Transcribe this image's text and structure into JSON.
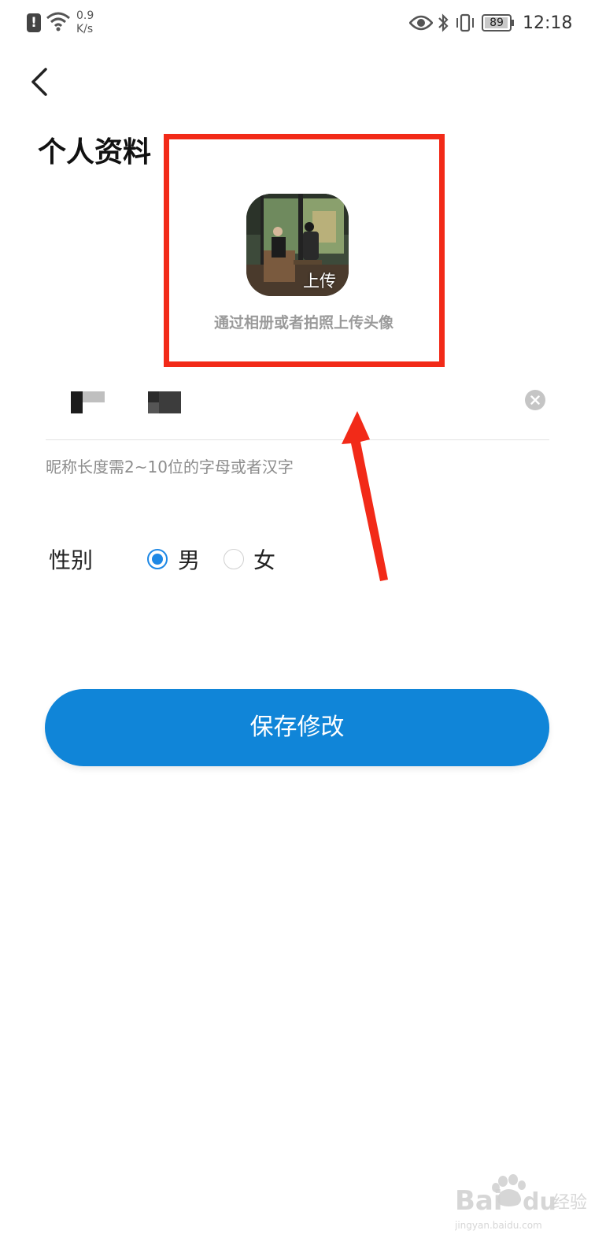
{
  "status_bar": {
    "net_speed_value": "0.9",
    "net_speed_unit": "K/s",
    "battery_level": "89",
    "time": "12:18"
  },
  "page": {
    "title": "个人资料"
  },
  "avatar": {
    "upload_label": "上传",
    "hint": "通过相册或者拍照上传头像"
  },
  "nickname": {
    "hint": "昵称长度需2~10位的字母或者汉字"
  },
  "gender": {
    "label": "性别",
    "options": [
      {
        "label": "男",
        "selected": true
      },
      {
        "label": "女",
        "selected": false
      }
    ]
  },
  "actions": {
    "save_label": "保存修改"
  },
  "colors": {
    "accent": "#1085d8",
    "annotation": "#f22a18"
  }
}
